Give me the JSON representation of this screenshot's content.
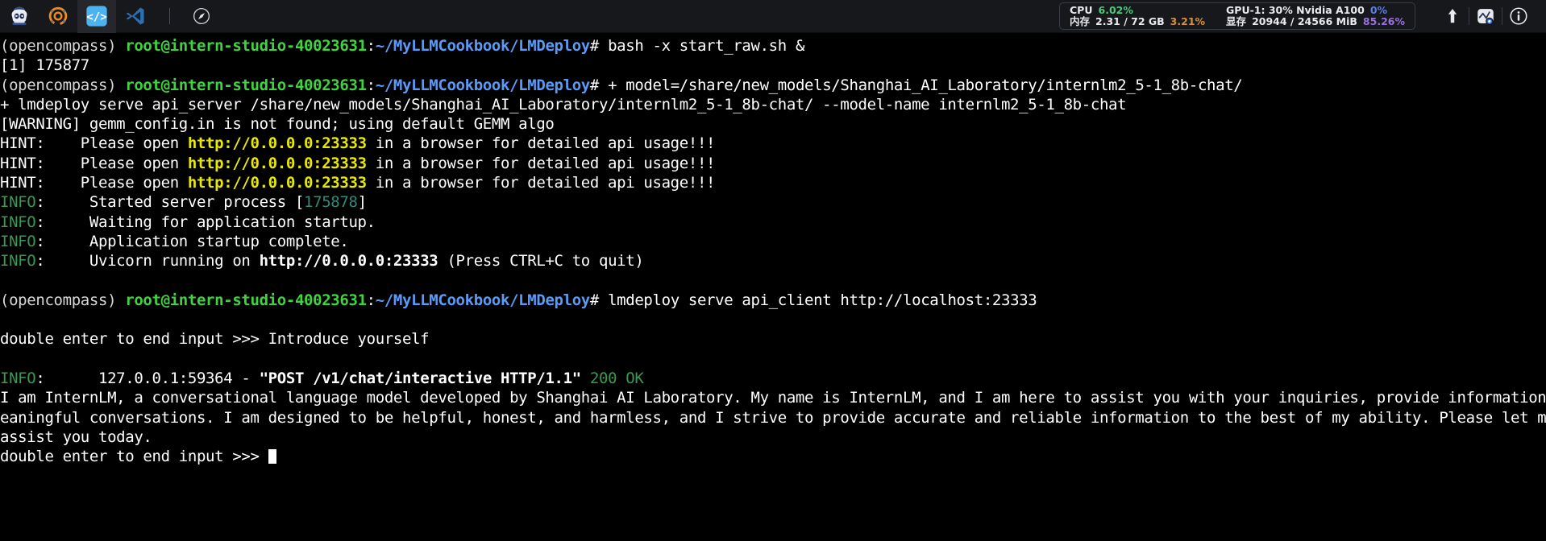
{
  "topbar": {
    "apps": [
      {
        "name": "intern-studio-logo-icon",
        "label": "InternStudio"
      },
      {
        "name": "opencompass-logo-icon",
        "label": "OpenCompass"
      },
      {
        "name": "code-brackets-icon",
        "label": "Code"
      },
      {
        "name": "vscode-icon",
        "label": "VS Code"
      }
    ],
    "compass_icon_label": "Compass",
    "stats": {
      "cpu_label": "CPU",
      "cpu_value": "6.02%",
      "cpu_color": "#4cc97a",
      "mem_label": "内存",
      "mem_value": "2.31 / 72 GB",
      "mem_pct": "3.21%",
      "mem_pct_color": "#d98f3a",
      "gpu_label": "GPU-1: 30% Nvidia A100",
      "gpu_pct": "0%",
      "gpu_pct_color": "#5b7fe8",
      "vram_label": "显存",
      "vram_value": "20944 / 24566 MiB",
      "vram_pct": "85.26%",
      "vram_pct_color": "#9b6fe0"
    },
    "right_icons": [
      {
        "name": "upload-arrow-icon",
        "label": "Upload"
      },
      {
        "name": "network-monitor-icon",
        "label": "Network"
      },
      {
        "name": "info-icon",
        "label": "Info"
      }
    ]
  },
  "terminal": {
    "prompt": {
      "env": "(opencompass) ",
      "userhost": "root@intern-studio-40023631",
      "colon": ":",
      "path": "~/MyLLMCookbook/LMDeploy",
      "hash": "# "
    },
    "url": "http://0.0.0.0:23333",
    "lines": {
      "cmd1": "bash -x start_raw.sh &",
      "job": "[1] 175877",
      "trace_model": "+ model=/share/new_models/Shanghai_AI_Laboratory/internlm2_5-1_8b-chat/",
      "trace_serve": "+ lmdeploy serve api_server /share/new_models/Shanghai_AI_Laboratory/internlm2_5-1_8b-chat/ --model-name internlm2_5-1_8b-chat",
      "warning": "[WARNING] gemm_config.in is not found; using default GEMM algo",
      "hint_prefix": "HINT:    Please open ",
      "hint_suffix": " in a browser for detailed api usage!!!",
      "info_label": "INFO",
      "started_server_pre": ":     Started server process [",
      "started_server_pid": "175878",
      "started_server_post": "]",
      "waiting": ":     Waiting for application startup.",
      "complete": ":     Application startup complete.",
      "uvicorn_pre": ":     Uvicorn running on ",
      "uvicorn_post": " (Press CTRL+C to quit)",
      "cmd2": "lmdeploy serve api_client http://localhost:23333",
      "input_prompt": "double enter to end input >>> ",
      "user_input": "Introduce yourself",
      "access_log_pre": ":      127.0.0.1:59364 - ",
      "access_log_req": "\"POST /v1/chat/interactive HTTP/1.1\"",
      "access_log_status": " 200 OK",
      "reply_l1": "I am InternLM, a conversational language model developed by Shanghai AI Laboratory. My name is InternLM, and I am here to assist you with your inquiries, provide information, and engage in m",
      "reply_l2": "eaningful conversations. I am designed to be helpful, honest, and harmless, and I strive to provide accurate and reliable information to the best of my ability. Please let me know how I can",
      "reply_l3": "assist you today.",
      "final_prompt": "double enter to end input >>> "
    }
  }
}
